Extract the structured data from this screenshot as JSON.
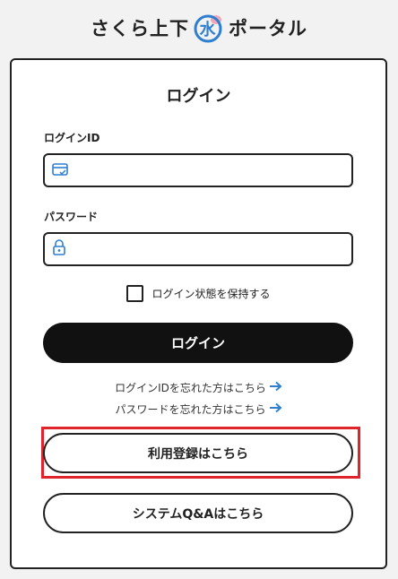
{
  "header": {
    "title_before": "さくら上下",
    "logo_char": "水",
    "title_after": "ポータル"
  },
  "login_card": {
    "title": "ログイン",
    "login_id_label": "ログインID",
    "login_id_value": "",
    "password_label": "パスワード",
    "password_value": "",
    "remember_label": "ログイン状態を保持する",
    "login_button": "ログイン",
    "forgot_id_link": "ログインIDを忘れた方はこちら",
    "forgot_password_link": "パスワードを忘れた方はこちら",
    "register_button": "利用登録はこちら",
    "faq_button": "システムQ&Aはこちら"
  },
  "colors": {
    "accent_blue": "#2f7fd0",
    "highlight_red": "#e0242b",
    "button_dark": "#111111"
  },
  "icons": {
    "login_id": "id-card-icon",
    "password": "lock-icon",
    "link_arrow": "arrow-right-icon"
  }
}
